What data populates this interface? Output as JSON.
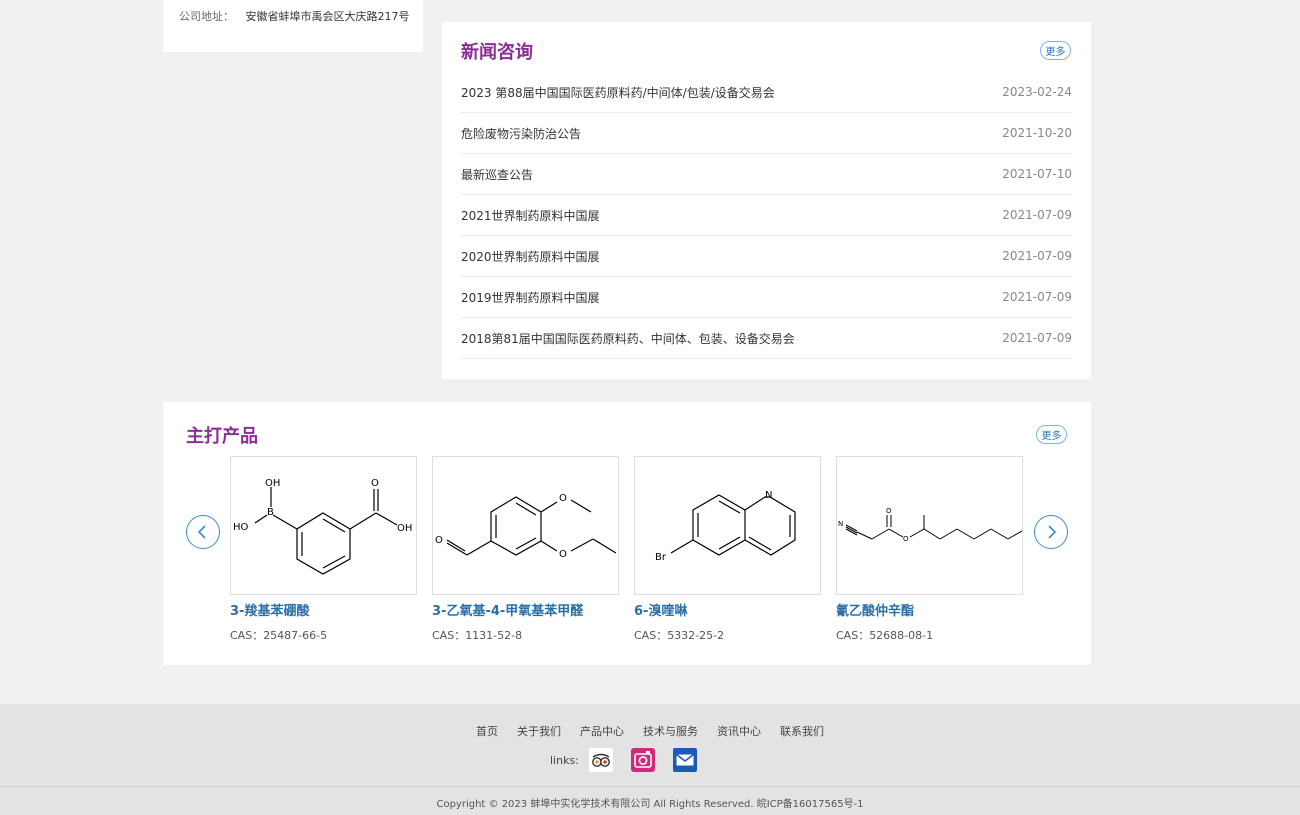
{
  "company": {
    "address_label": "公司地址：",
    "address": "安徽省蚌埠市禹会区大庆路217号"
  },
  "news": {
    "title": "新闻咨询",
    "more": "更多",
    "items": [
      {
        "title": "2023 第88届中国国际医药原料药/中间体/包装/设备交易会",
        "date": "2023-02-24"
      },
      {
        "title": "危险废物污染防治公告",
        "date": "2021-10-20"
      },
      {
        "title": "最新巡查公告",
        "date": "2021-07-10"
      },
      {
        "title": "2021世界制药原料中国展",
        "date": "2021-07-09"
      },
      {
        "title": "2020世界制药原料中国展",
        "date": "2021-07-09"
      },
      {
        "title": "2019世界制药原料中国展",
        "date": "2021-07-09"
      },
      {
        "title": "2018第81届中国国际医药原料药、中间体、包装、设备交易会",
        "date": "2021-07-09"
      }
    ]
  },
  "products": {
    "title": "主打产品",
    "more": "更多",
    "items": [
      {
        "name": "3-羧基苯硼酸",
        "cas": "CAS：25487-66-5"
      },
      {
        "name": "3-乙氧基-4-甲氧基苯甲醛",
        "cas": "CAS：1131-52-8"
      },
      {
        "name": "6-溴喹啉",
        "cas": "CAS：5332-25-2"
      },
      {
        "name": "氰乙酸仲辛酯",
        "cas": "CAS：52688-08-1"
      }
    ],
    "structure_labels": {
      "p1": {
        "oh_top": "OH",
        "b": "B",
        "ho": "HO",
        "o": "O",
        "oh": "OH"
      },
      "p2": {
        "o_top": "O",
        "o_ald": "O",
        "o_eth": "O"
      },
      "p3": {
        "n": "N",
        "br": "Br"
      },
      "p4": {
        "n": "N",
        "o_top": "O",
        "o_mid": "O"
      }
    }
  },
  "footer": {
    "nav": [
      "首页",
      "关于我们",
      "产品中心",
      "技术与服务",
      "资讯中心",
      "联系我们"
    ],
    "links_label": "links:",
    "link_icons": [
      "tripadvisor-icon",
      "instagram-icon",
      "mail-icon"
    ],
    "copyright": "Copyright © 2023 蚌埠中实化学技术有限公司 All Rights Reserved. 皖ICP备16017565号-1"
  },
  "colors": {
    "accent_purple": "#8b2f95",
    "link_blue": "#2a6fa8",
    "page_bg": "#f1f1f1",
    "footer_bg": "#e3e3e3"
  }
}
